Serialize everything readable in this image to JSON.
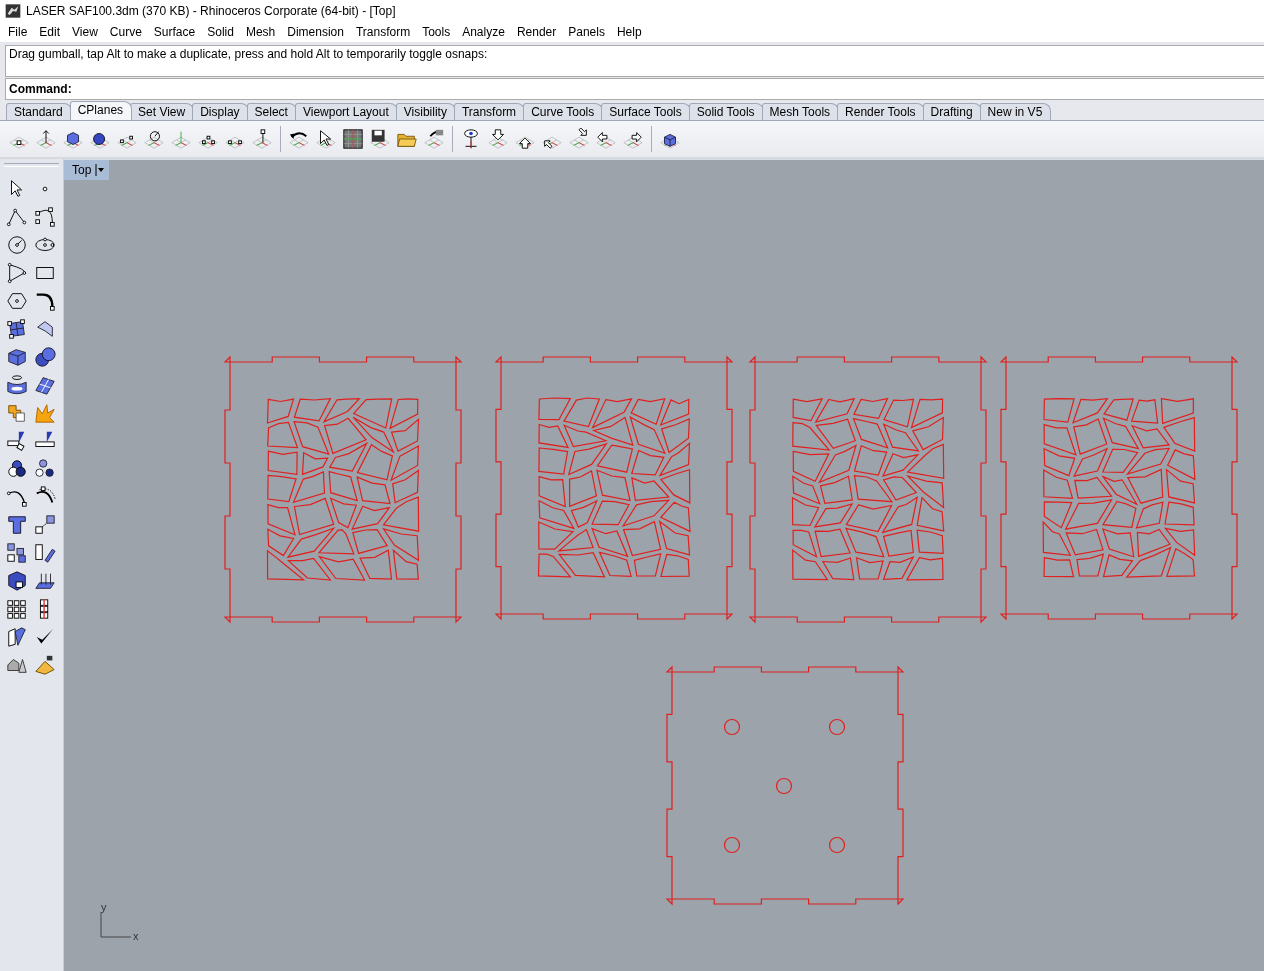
{
  "window": {
    "title": "LASER SAF100.3dm (370 KB) - Rhinoceros Corporate (64-bit) - [Top]"
  },
  "menu": [
    "File",
    "Edit",
    "View",
    "Curve",
    "Surface",
    "Solid",
    "Mesh",
    "Dimension",
    "Transform",
    "Tools",
    "Analyze",
    "Render",
    "Panels",
    "Help"
  ],
  "command": {
    "history": "Drag gumball, tap Alt to make a duplicate, press and hold Alt to temporarily toggle osnaps:",
    "prompt": "Command:"
  },
  "tabs": [
    {
      "label": "Standard",
      "selected": false
    },
    {
      "label": "CPlanes",
      "selected": true
    },
    {
      "label": "Set View",
      "selected": false
    },
    {
      "label": "Display",
      "selected": false
    },
    {
      "label": "Select",
      "selected": false
    },
    {
      "label": "Viewport Layout",
      "selected": false
    },
    {
      "label": "Visibility",
      "selected": false
    },
    {
      "label": "Transform",
      "selected": false
    },
    {
      "label": "Curve Tools",
      "selected": false
    },
    {
      "label": "Surface Tools",
      "selected": false
    },
    {
      "label": "Solid Tools",
      "selected": false
    },
    {
      "label": "Mesh Tools",
      "selected": false
    },
    {
      "label": "Render Tools",
      "selected": false
    },
    {
      "label": "Drafting",
      "selected": false
    },
    {
      "label": "New in V5",
      "selected": false
    }
  ],
  "viewport": {
    "title": "Top",
    "axis_labels": [
      "y",
      "x"
    ]
  }
}
